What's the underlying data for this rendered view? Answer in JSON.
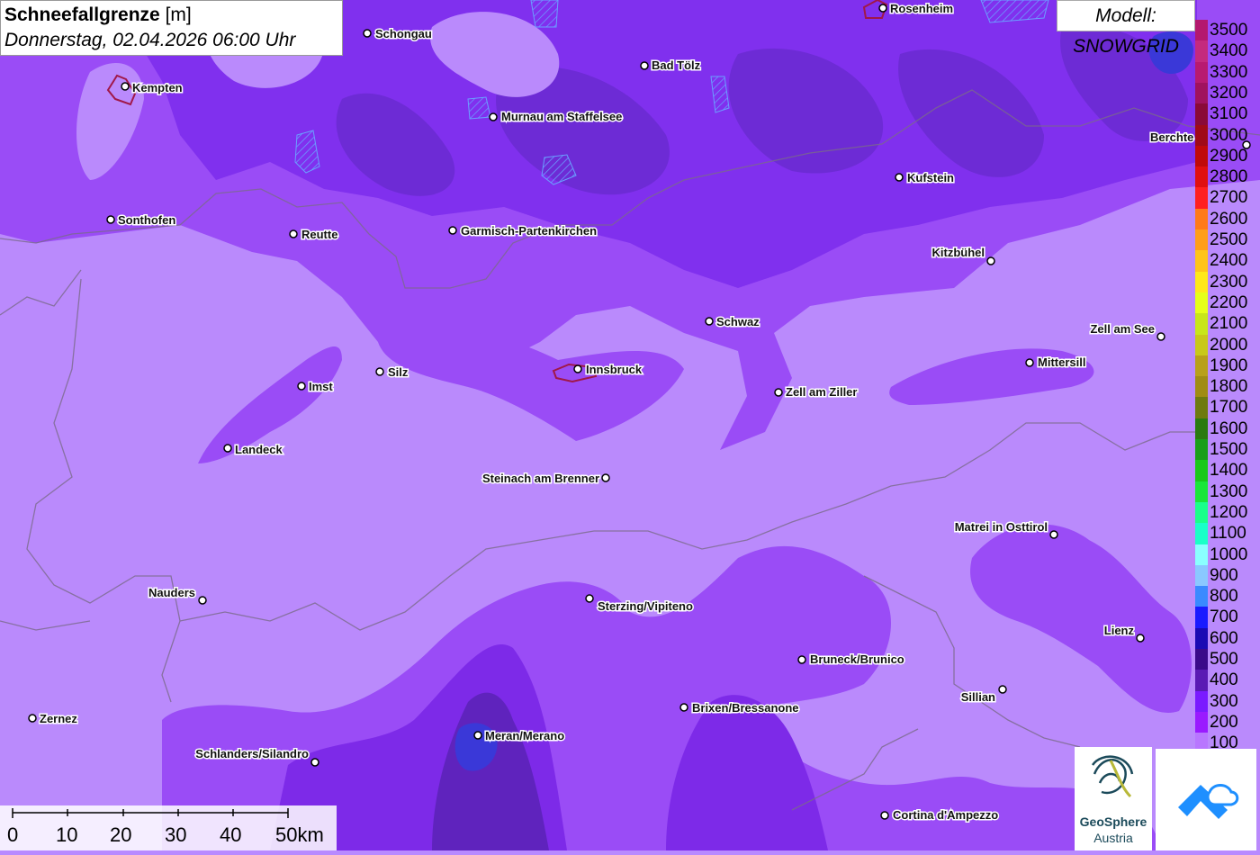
{
  "header": {
    "title_bold": "Schneefallgrenze",
    "title_unit": "[m]",
    "datetime": "Donnerstag, 02.04.2026 06:00 Uhr",
    "model": "Modell: SNOWGRID"
  },
  "legend": {
    "entries": [
      {
        "label": "3500",
        "color": "#b4186e"
      },
      {
        "label": "3400",
        "color": "#c42a7e"
      },
      {
        "label": "3300",
        "color": "#b81a70"
      },
      {
        "label": "3200",
        "color": "#a0125e"
      },
      {
        "label": "3100",
        "color": "#8a0a38"
      },
      {
        "label": "3000",
        "color": "#a00a18"
      },
      {
        "label": "2900",
        "color": "#c00a0a"
      },
      {
        "label": "2800",
        "color": "#e01010"
      },
      {
        "label": "2700",
        "color": "#ff2020"
      },
      {
        "label": "2600",
        "color": "#ff7a1a"
      },
      {
        "label": "2500",
        "color": "#ff9e1a"
      },
      {
        "label": "2400",
        "color": "#ffc41a"
      },
      {
        "label": "2300",
        "color": "#ffe81a"
      },
      {
        "label": "2200",
        "color": "#e6ff1a"
      },
      {
        "label": "2100",
        "color": "#c8e61a"
      },
      {
        "label": "2000",
        "color": "#c8c81a"
      },
      {
        "label": "1900",
        "color": "#b8a01a"
      },
      {
        "label": "1800",
        "color": "#a08c14"
      },
      {
        "label": "1700",
        "color": "#6e7a10"
      },
      {
        "label": "1600",
        "color": "#2a7a10"
      },
      {
        "label": "1500",
        "color": "#1a9e1a"
      },
      {
        "label": "1400",
        "color": "#1ac81a"
      },
      {
        "label": "1300",
        "color": "#1ae63a"
      },
      {
        "label": "1200",
        "color": "#1aff8a"
      },
      {
        "label": "1100",
        "color": "#1affc8"
      },
      {
        "label": "1000",
        "color": "#8affff"
      },
      {
        "label": "900",
        "color": "#8ac8ff"
      },
      {
        "label": "800",
        "color": "#3a8aff"
      },
      {
        "label": "700",
        "color": "#1a1aff"
      },
      {
        "label": "600",
        "color": "#1a0ab4"
      },
      {
        "label": "500",
        "color": "#3a0a8a"
      },
      {
        "label": "400",
        "color": "#5a1ab4"
      },
      {
        "label": "300",
        "color": "#7a1aff"
      },
      {
        "label": "200",
        "color": "#9a1aff"
      },
      {
        "label": "100",
        "color": "#b876ff"
      }
    ]
  },
  "cities": [
    {
      "name": "Schongau"
    },
    {
      "name": "Rosenheim"
    },
    {
      "name": "Bad Tölz"
    },
    {
      "name": "Kempten"
    },
    {
      "name": "Murnau am Staffelsee"
    },
    {
      "name": "Berchte"
    },
    {
      "name": "Kufstein"
    },
    {
      "name": "Sonthofen"
    },
    {
      "name": "Reutte"
    },
    {
      "name": "Garmisch-Partenkirchen"
    },
    {
      "name": "Kitzbühel"
    },
    {
      "name": "Schwaz"
    },
    {
      "name": "Zell am See"
    },
    {
      "name": "Mittersill"
    },
    {
      "name": "Innsbruck"
    },
    {
      "name": "Silz"
    },
    {
      "name": "Imst"
    },
    {
      "name": "Zell am Ziller"
    },
    {
      "name": "Landeck"
    },
    {
      "name": "Steinach am Brenner"
    },
    {
      "name": "Matrei in Osttirol"
    },
    {
      "name": "Nauders"
    },
    {
      "name": "Sterzing/Vipiteno"
    },
    {
      "name": "Lienz"
    },
    {
      "name": "Bruneck/Brunico"
    },
    {
      "name": "Sillian"
    },
    {
      "name": "Brixen/Bressanone"
    },
    {
      "name": "Zernez"
    },
    {
      "name": "Meran/Merano"
    },
    {
      "name": "Schlanders/Silandro"
    },
    {
      "name": "Cortina d'Ampezzo"
    }
  ],
  "scale": {
    "ticks": [
      "0",
      "10",
      "20",
      "30",
      "40",
      "50km"
    ]
  },
  "logos": {
    "geosphere_line1": "GeoSphere",
    "geosphere_line2": "Austria"
  }
}
